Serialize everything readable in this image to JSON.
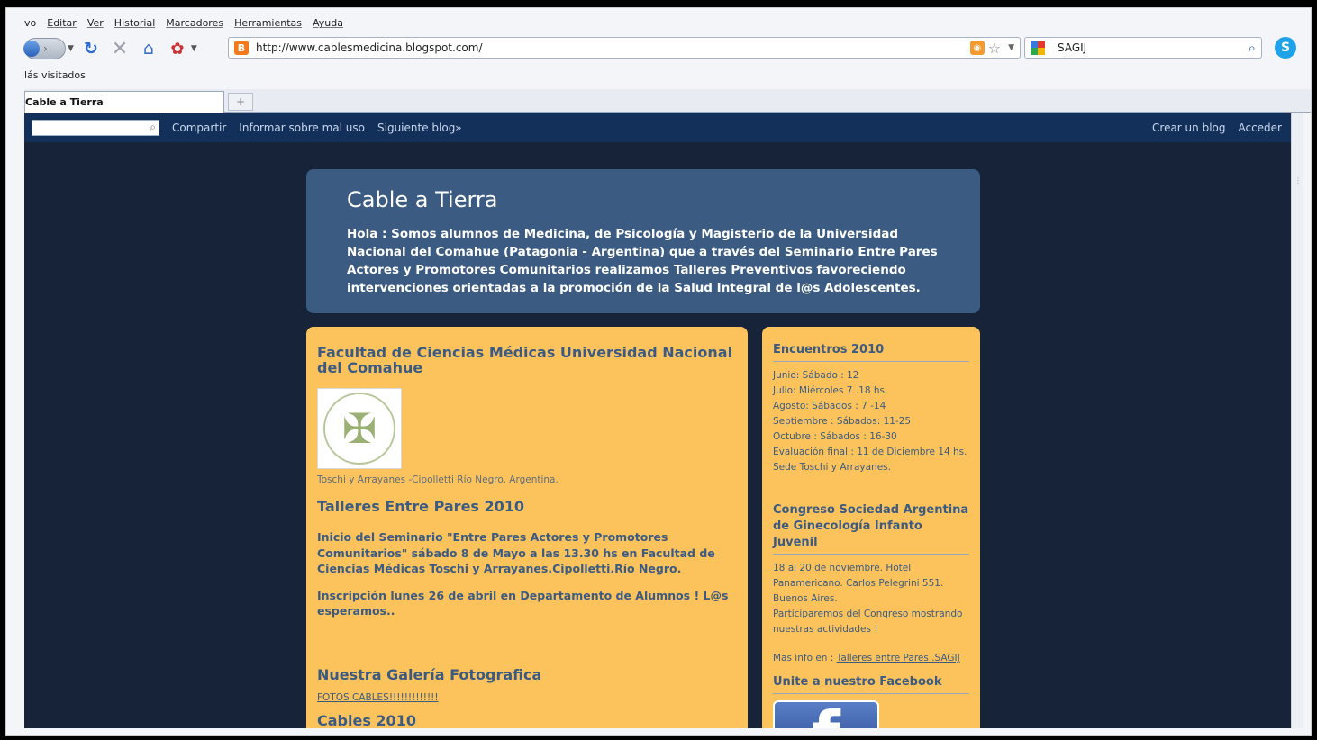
{
  "menubar": {
    "items": [
      "vo",
      "Editar",
      "Ver",
      "Historial",
      "Marcadores",
      "Herramientas",
      "Ayuda"
    ]
  },
  "navbar": {
    "url": "http://www.cablesmedicina.blogspot.com/",
    "search_value": "SAGIJ"
  },
  "bookmarks": {
    "label": "lás visitados"
  },
  "tabs": [
    {
      "label": "Cable a Tierra"
    }
  ],
  "newtab_label": "+",
  "blogger_nav": {
    "share": "Compartir",
    "report": "Informar sobre mal uso",
    "next": "Siguiente blog»",
    "create": "Crear un blog",
    "signin": "Acceder"
  },
  "header": {
    "title": "Cable a Tierra",
    "description": "Hola : Somos alumnos de Medicina, de Psicología y Magisterio de la Universidad Nacional del Comahue (Patagonia - Argentina) que a través del Seminario Entre Pares Actores y Promotores Comunitarios realizamos Talleres Preventivos favoreciendo intervenciones orientadas a la promoción de la Salud Integral de l@s Adolescentes."
  },
  "main": {
    "heading": "Facultad de Ciencias Médicas Universidad Nacional del Comahue",
    "caption": "Toschi y Arrayanes -Cipolletti Río Negro. Argentina.",
    "post_title": "Talleres Entre Pares 2010",
    "para1": "Inicio del Seminario \"Entre Pares Actores y Promotores Comunitarios\" sábado 8 de Mayo a las 13.30 hs en Facultad de Ciencias Médicas Toschi y Arrayanes.Cipolletti.Río Negro.",
    "para2": "Inscripción lunes 26 de abril en Departamento de Alumnos ! L@s esperamos..",
    "gallery_title": "Nuestra Galería Fotografica",
    "gallery_link": "FOTOS CABLES!!!!!!!!!!!!!",
    "cut_title": "Cables 2010"
  },
  "sidebar": {
    "encuentros_title": "Encuentros 2010",
    "encuentros": [
      "Junio: Sábado : 12",
      "Julio: Miércoles 7 .18 hs.",
      "Agosto: Sábados : 7 -14",
      "Septiembre : Sábados: 11-25",
      "Octubre : Sábados : 16-30",
      "Evaluación final : 11 de Diciembre 14 hs.",
      "Sede Toschi y Arrayanes."
    ],
    "congreso_title": "Congreso Sociedad Argentina de Ginecología Infanto Juvenil",
    "congreso": [
      "18 al 20 de noviembre. Hotel",
      "Panamericano. Carlos Pelegrini 551.",
      "Buenos Aires.",
      "Participaremos del Congreso mostrando",
      "nuestras actividades !"
    ],
    "more_prefix": "Mas info en : ",
    "more_link": "Talleres entre Pares .SAGIJ",
    "facebook_title": "Unite a nuestro Facebook",
    "facebook_glyph": "f"
  }
}
